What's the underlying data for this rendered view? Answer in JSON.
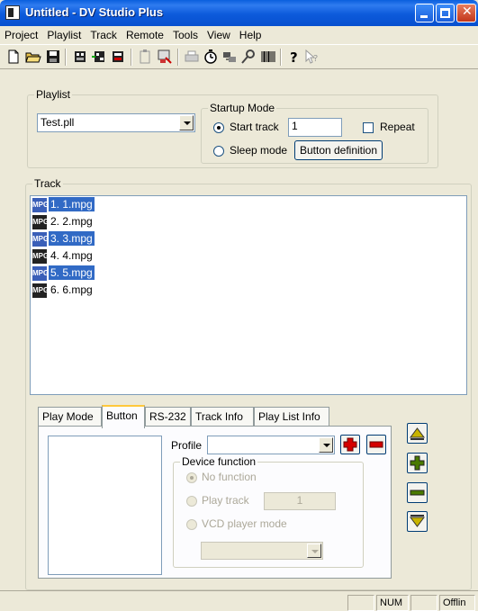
{
  "window": {
    "title": "Untitled - DV Studio Plus"
  },
  "menu": [
    "Project",
    "Playlist",
    "Track",
    "Remote",
    "Tools",
    "View",
    "Help"
  ],
  "toolbar_icons": [
    "new-icon",
    "open-icon",
    "save-icon",
    "track-add-icon",
    "track-import-icon",
    "track-export-icon",
    "paste-icon",
    "format-icon",
    "print-icon",
    "timer-icon",
    "connect-icon",
    "settings-icon",
    "barcode-icon",
    "help-icon",
    "whats-this-icon"
  ],
  "playlist": {
    "label": "Playlist",
    "selected": "Test.pll"
  },
  "startup_mode": {
    "label": "Startup Mode",
    "start_track_label": "Start track",
    "start_track_value": "1",
    "repeat_label": "Repeat",
    "sleep_mode_label": "Sleep mode",
    "button_definition_label": "Button definition"
  },
  "track": {
    "label": "Track",
    "items": [
      {
        "text": "1. 1.mpg",
        "selected": true
      },
      {
        "text": "2. 2.mpg",
        "selected": false
      },
      {
        "text": "3. 3.mpg",
        "selected": true
      },
      {
        "text": "4. 4.mpg",
        "selected": false
      },
      {
        "text": "5. 5.mpg",
        "selected": true
      },
      {
        "text": "6. 6.mpg",
        "selected": false
      }
    ]
  },
  "tabs": [
    "Play Mode",
    "Button",
    "RS-232",
    "Track Info",
    "Play List Info"
  ],
  "active_tab": "Button",
  "button_tab": {
    "profile_label": "Profile",
    "profile_value": "",
    "device_function_label": "Device function",
    "no_function_label": "No function",
    "play_track_label": "Play track",
    "play_track_value": "1",
    "vcd_player_label": "VCD player mode",
    "vcd_value": ""
  },
  "statusbar": {
    "num": "NUM",
    "offline": "Offlin"
  },
  "colors": {
    "title_bar": "#0A5FDE",
    "selection": "#316AC5",
    "face": "#ECE9D8"
  }
}
